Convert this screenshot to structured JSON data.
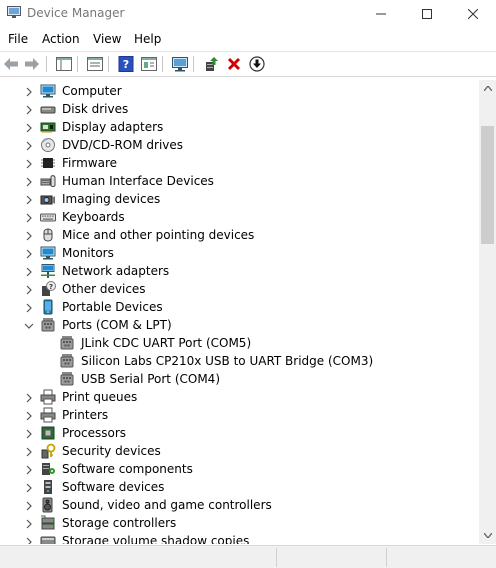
{
  "window": {
    "title": "Device Manager"
  },
  "menu": [
    "File",
    "Action",
    "View",
    "Help"
  ],
  "toolbar": {
    "buttons": [
      "back-icon",
      "forward-icon",
      "show-hide-console-tree-icon",
      "properties-icon",
      "help-icon",
      "view-icon",
      "scan-hardware-icon",
      "update-driver-icon",
      "uninstall-icon",
      "disable-device-icon"
    ]
  },
  "tree": {
    "categories": [
      {
        "label": "Computer",
        "icon": "computer-icon",
        "expanded": false
      },
      {
        "label": "Disk drives",
        "icon": "disk-drive-icon",
        "expanded": false
      },
      {
        "label": "Display adapters",
        "icon": "display-adapter-icon",
        "expanded": false
      },
      {
        "label": "DVD/CD-ROM drives",
        "icon": "dvd-icon",
        "expanded": false
      },
      {
        "label": "Firmware",
        "icon": "firmware-icon",
        "expanded": false
      },
      {
        "label": "Human Interface Devices",
        "icon": "hid-icon",
        "expanded": false
      },
      {
        "label": "Imaging devices",
        "icon": "camera-icon",
        "expanded": false
      },
      {
        "label": "Keyboards",
        "icon": "keyboard-icon",
        "expanded": false
      },
      {
        "label": "Mice and other pointing devices",
        "icon": "mouse-icon",
        "expanded": false
      },
      {
        "label": "Monitors",
        "icon": "monitor-icon",
        "expanded": false
      },
      {
        "label": "Network adapters",
        "icon": "network-icon",
        "expanded": false
      },
      {
        "label": "Other devices",
        "icon": "unknown-device-icon",
        "expanded": false
      },
      {
        "label": "Portable Devices",
        "icon": "portable-device-icon",
        "expanded": false
      },
      {
        "label": "Ports (COM & LPT)",
        "icon": "port-icon",
        "expanded": true,
        "children": [
          {
            "label": "JLink CDC UART Port (COM5)",
            "icon": "port-icon"
          },
          {
            "label": "Silicon Labs CP210x USB to UART Bridge (COM3)",
            "icon": "port-icon"
          },
          {
            "label": "USB Serial Port (COM4)",
            "icon": "port-icon"
          }
        ]
      },
      {
        "label": "Print queues",
        "icon": "printer-icon",
        "expanded": false
      },
      {
        "label": "Printers",
        "icon": "printer-icon",
        "expanded": false
      },
      {
        "label": "Processors",
        "icon": "processor-icon",
        "expanded": false
      },
      {
        "label": "Security devices",
        "icon": "security-key-icon",
        "expanded": false
      },
      {
        "label": "Software components",
        "icon": "software-component-icon",
        "expanded": false
      },
      {
        "label": "Software devices",
        "icon": "software-device-icon",
        "expanded": false
      },
      {
        "label": "Sound, video and game controllers",
        "icon": "speaker-icon",
        "expanded": false
      },
      {
        "label": "Storage controllers",
        "icon": "storage-controller-icon",
        "expanded": false
      },
      {
        "label": "Storage volume shadow copies",
        "icon": "storage-volume-icon",
        "expanded": false
      }
    ]
  },
  "colors": {
    "accent_blue": "#1e8bd6",
    "delete_red": "#d40000",
    "scan_green": "#2e8b2e"
  }
}
